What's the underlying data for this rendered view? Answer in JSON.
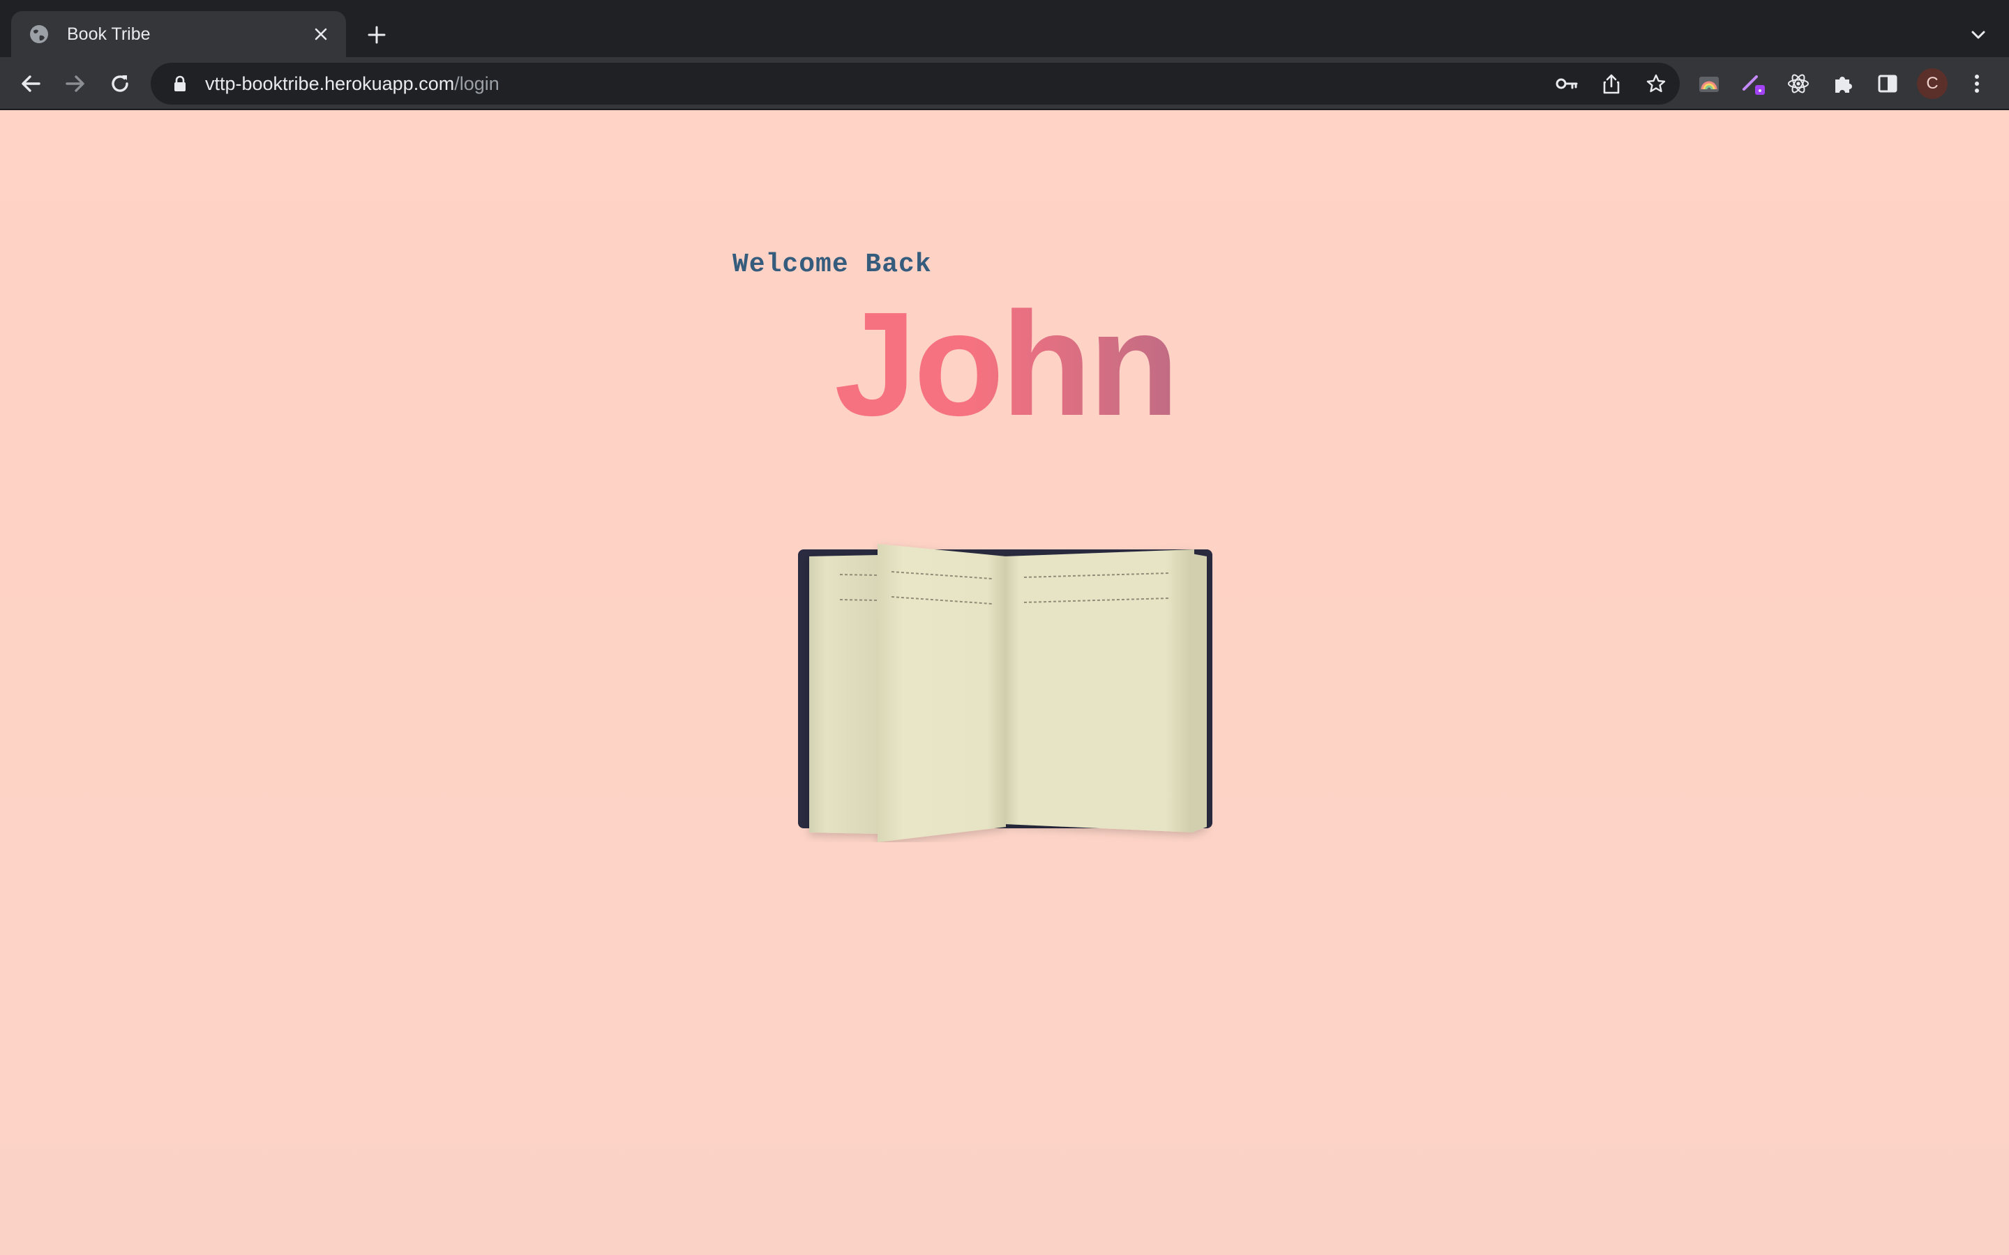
{
  "browser": {
    "tab": {
      "title": "Book Tribe",
      "favicon": "globe-icon",
      "close_icon": "close-icon"
    },
    "new_tab_icon": "plus-icon",
    "tab_search_icon": "chevron-down-icon",
    "nav": {
      "back_icon": "arrow-left-icon",
      "forward_icon": "arrow-right-icon",
      "reload_icon": "reload-icon"
    },
    "address": {
      "lock_icon": "lock-icon",
      "host": "vttp-booktribe.herokuapp.com",
      "path": "/login"
    },
    "omnibox_icons": [
      "key-icon",
      "share-icon",
      "star-icon"
    ],
    "extensions": [
      "rainbow-extension-icon",
      "pen-extension-icon",
      "react-icon",
      "puzzle-icon",
      "side-panel-icon"
    ],
    "profile_initial": "C",
    "menu_icon": "kebab-menu-icon"
  },
  "page": {
    "welcome_text": "Welcome Back",
    "user_name": "John",
    "illustration": "open-book-illustration"
  },
  "colors": {
    "background": "#ffd5c8",
    "welcome": "#355c7d",
    "name_start": "#f67280",
    "name_end": "#c06c84",
    "book_cover": "#2a2a40",
    "book_page": "#e6e4c4"
  }
}
